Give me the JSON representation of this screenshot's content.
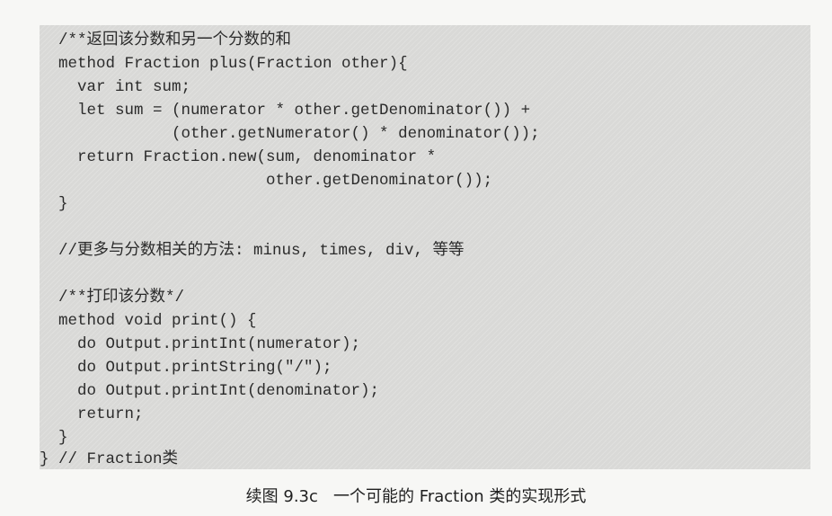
{
  "code_lines": [
    "  /**返回该分数和另一个分数的和",
    "  method Fraction plus(Fraction other){",
    "    var int sum;",
    "    let sum = (numerator * other.getDenominator()) +",
    "              (other.getNumerator() * denominator());",
    "    return Fraction.new(sum, denominator *",
    "                        other.getDenominator());",
    "  }",
    "",
    "  //更多与分数相关的方法: minus, times, div, 等等",
    "",
    "  /**打印该分数*/",
    "  method void print() {",
    "    do Output.printInt(numerator);",
    "    do Output.printString(\"/\");",
    "    do Output.printInt(denominator);",
    "    return;",
    "  }",
    "} // Fraction类"
  ],
  "caption": "续图 9.3c   一个可能的 Fraction 类的实现形式"
}
